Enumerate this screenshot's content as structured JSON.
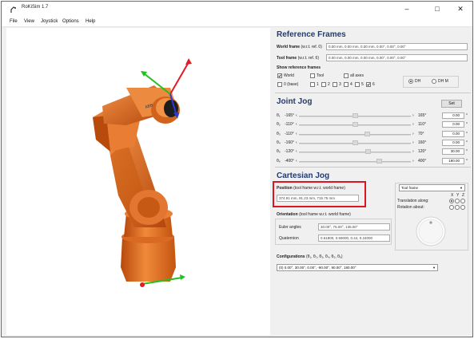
{
  "window": {
    "title": "RoKiSim 1.7",
    "minimize": "–",
    "maximize": "□",
    "close": "✕"
  },
  "menu": [
    "File",
    "View",
    "Joystick",
    "Options",
    "Help"
  ],
  "ref_frames": {
    "title": "Reference Frames",
    "world_label_bold": "World frame",
    "world_label_rest": "(w.r.t. ref. 0)",
    "world_value": "0.00 mm, 0.00 mm, 0.00 mm, 0.00°, 0.00°, 0.00°",
    "tool_label_bold": "Tool frame",
    "tool_label_rest": "(w.r.t. ref. 6)",
    "tool_value": "0.00 mm, 0.00 mm, 0.00 mm, 0.00°, 0.00°, 0.00°",
    "show_label": "Show reference frames",
    "cb_world": "World",
    "cb_tool": "Tool",
    "cb_all": "all axes",
    "idx0": "0 (base)",
    "idx1": "1",
    "idx2": "2",
    "idx3": "3",
    "idx4": "4",
    "idx5": "5",
    "idx6": "6",
    "radio_dh": "DH",
    "radio_dhm": "DH M"
  },
  "joint_jog": {
    "title": "Joint Jog",
    "set_button": "Set",
    "joints": [
      {
        "label": "θ₁",
        "min": "-165°",
        "max": "165°",
        "value": "0.00",
        "pos": 0.5
      },
      {
        "label": "θ₂",
        "min": "-110°",
        "max": "110°",
        "value": "0.00",
        "pos": 0.5
      },
      {
        "label": "θ₃",
        "min": "-110°",
        "max": "70°",
        "value": "0.00",
        "pos": 0.61
      },
      {
        "label": "θ₄",
        "min": "-160°",
        "max": "160°",
        "value": "0.00",
        "pos": 0.5
      },
      {
        "label": "θ₅",
        "min": "-120°",
        "max": "120°",
        "value": "30.00",
        "pos": 0.62
      },
      {
        "label": "θ₆",
        "min": "-400°",
        "max": "400°",
        "value": "180.00",
        "pos": 0.72
      }
    ]
  },
  "cartesian_jog": {
    "title": "Cartesian Jog",
    "position_label_bold": "Position",
    "position_label_rest": "(tool frame w.r.t. world frame)",
    "position_value": "374.91 mm, 91.23 mm, 715.75 mm",
    "orientation_label_bold": "Orientation",
    "orientation_label_rest": "(tool frame w.r.t. world frame)",
    "euler_label": "Euler angles",
    "euler_value": "30.00°, 75.00°, 135.00°",
    "quaternion_label": "Quaternion",
    "quaternion_value": "0.61800, 0.59000, 0.44, 0.24000",
    "frame_select": "Tool frame",
    "translation_label": "Translation along:",
    "rotation_label": "Rotation about:",
    "axes": [
      "X",
      "Y",
      "Z"
    ],
    "config_label_bold": "Configurations",
    "config_label_rest": "(θ₁, θ₂, θ₃, θ₄, θ₅, θ₆)",
    "config_value": "(0) 0.00°, 30.00°, 0.00°, -90.00°, 90.00°, 180.00°"
  },
  "colors": {
    "robot": "#e46c1c",
    "section_title": "#223a6e",
    "highlight": "#e0141e",
    "axis_x": "#e11c24",
    "axis_y": "#22c122",
    "axis_z": "#2c3ad8"
  }
}
